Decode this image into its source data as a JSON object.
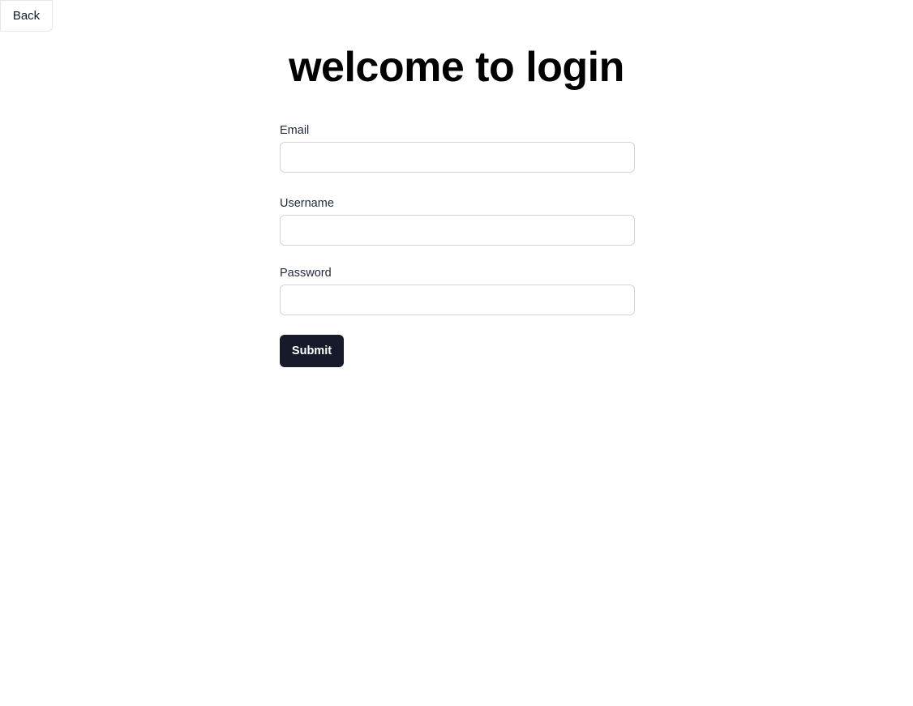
{
  "nav": {
    "back_label": "Back"
  },
  "page": {
    "title": "welcome to login"
  },
  "form": {
    "email": {
      "label": "Email",
      "value": "",
      "placeholder": ""
    },
    "username": {
      "label": "Username",
      "value": "",
      "placeholder": ""
    },
    "password": {
      "label": "Password",
      "value": "",
      "placeholder": ""
    },
    "submit_label": "Submit"
  },
  "colors": {
    "submit_bg": "#171a2b",
    "input_border": "#d1d5db",
    "label_text": "#1e293b"
  }
}
